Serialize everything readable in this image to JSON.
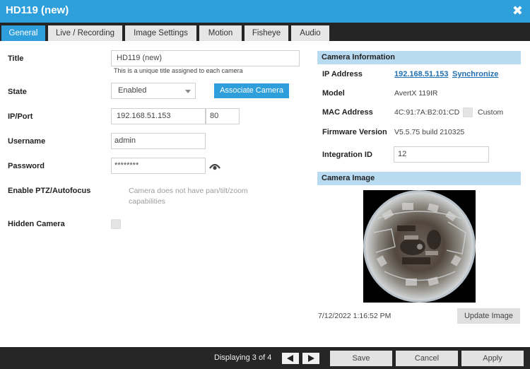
{
  "window": {
    "title": "HD119 (new)",
    "close_glyph": "✖"
  },
  "tabs": [
    {
      "label": "General"
    },
    {
      "label": "Live / Recording"
    },
    {
      "label": "Image Settings"
    },
    {
      "label": "Motion"
    },
    {
      "label": "Fisheye"
    },
    {
      "label": "Audio"
    }
  ],
  "form": {
    "title_label": "Title",
    "title_value": "HD119 (new)",
    "title_hint": "This is a unique title assigned to each camera",
    "state_label": "State",
    "state_value": "Enabled",
    "associate_label": "Associate Camera",
    "ipport_label": "IP/Port",
    "ip_value": "192.168.51.153",
    "port_value": "80",
    "username_label": "Username",
    "username_value": "admin",
    "password_label": "Password",
    "password_value": "********",
    "ptz_label": "Enable PTZ/Autofocus",
    "ptz_note": "Camera does not have pan/tilt/zoom capabilities",
    "hidden_label": "Hidden Camera"
  },
  "camera_info": {
    "header": "Camera Information",
    "ip_label": "IP Address",
    "ip_link": "192.168.51.153",
    "sync_link": "Synchronize",
    "model_label": "Model",
    "model_value": "AvertX 119IR",
    "mac_label": "MAC Address",
    "mac_value": "4C:91:7A:B2:01:CD",
    "custom_label": "Custom",
    "firmware_label": "Firmware Version",
    "firmware_value": "V5.5.75 build 210325",
    "integration_label": "Integration ID",
    "integration_value": "12"
  },
  "camera_image": {
    "header": "Camera Image",
    "timestamp": "7/12/2022 1:16:52 PM",
    "update_label": "Update Image"
  },
  "footer": {
    "displaying": "Displaying 3 of 4",
    "save_label": "Save",
    "cancel_label": "Cancel",
    "apply_label": "Apply"
  },
  "colors": {
    "accent": "#2f9fdc",
    "section_header": "#b9dbf2",
    "dark_bar": "#252525"
  }
}
